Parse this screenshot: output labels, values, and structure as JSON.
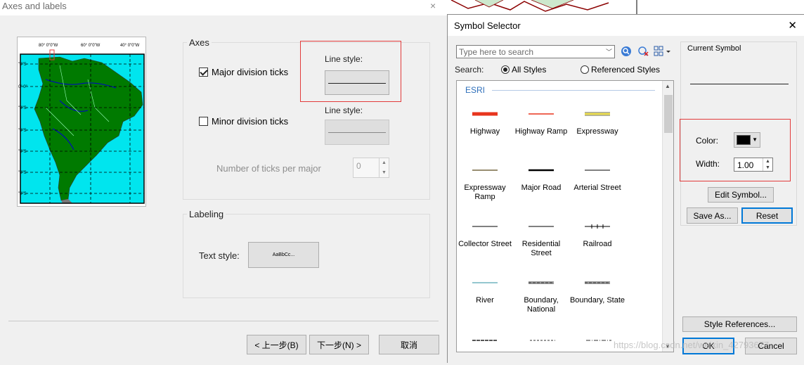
{
  "wizard": {
    "title": "Axes and labels",
    "close_glyph": "×",
    "axes": {
      "group_label": "Axes",
      "major_ticks": {
        "label": "Major division ticks",
        "checked": true
      },
      "major_line_label": "Line style:",
      "minor_ticks": {
        "label": "Minor division ticks",
        "checked": false
      },
      "minor_line_label": "Line style:",
      "ticks_per_major_label": "Number of ticks per major",
      "ticks_per_major_value": "0"
    },
    "labeling": {
      "group_label": "Labeling",
      "text_style_label": "Text style:",
      "text_style_sample": "AaBbCc..."
    },
    "buttons": {
      "back": "< 上一步(B)",
      "next": "下一步(N) >",
      "cancel": "取消"
    },
    "map_labels": {
      "top": [
        "80° 0\"0\"W",
        "60° 0\"0\"W",
        "40° 0\"0\"W"
      ],
      "left": [
        "\"0\"S",
        "0\" 0\"",
        "\"0\"S",
        "\"0\"S",
        "\"0\"S",
        "\"0\"S",
        "\"0\"S"
      ]
    }
  },
  "symbol_selector": {
    "title": "Symbol Selector",
    "close_glyph": "✕",
    "search_placeholder": "Type here to search",
    "search_label": "Search:",
    "scope_all": "All Styles",
    "scope_referenced": "Referenced Styles",
    "group_name": "ESRI",
    "symbols": [
      {
        "name": "Highway",
        "style": "thick-red"
      },
      {
        "name": "Highway Ramp",
        "style": "thin-red"
      },
      {
        "name": "Expressway",
        "style": "double-olive"
      },
      {
        "name": "Expressway Ramp",
        "style": "thin-olive"
      },
      {
        "name": "Major Road",
        "style": "thick-black"
      },
      {
        "name": "Arterial Street",
        "style": "thin-black"
      },
      {
        "name": "Collector Street",
        "style": "thin-black"
      },
      {
        "name": "Residential Street",
        "style": "thin-black"
      },
      {
        "name": "Railroad",
        "style": "railroad"
      },
      {
        "name": "River",
        "style": "river"
      },
      {
        "name": "Boundary, National",
        "style": "boundary"
      },
      {
        "name": "Boundary, State",
        "style": "boundary"
      }
    ],
    "current_symbol_label": "Current Symbol",
    "color_label": "Color:",
    "width_label": "Width:",
    "width_value": "1.00",
    "edit_symbol": "Edit Symbol...",
    "save_as": "Save As...",
    "reset": "Reset",
    "style_references": "Style References...",
    "ok": "OK",
    "cancel": "Cancel",
    "watermark": "https://blog.csdn.net/weixin_42793677",
    "colors": {
      "selected_color": "#000000",
      "highlight_box": "#e23b3b"
    }
  }
}
